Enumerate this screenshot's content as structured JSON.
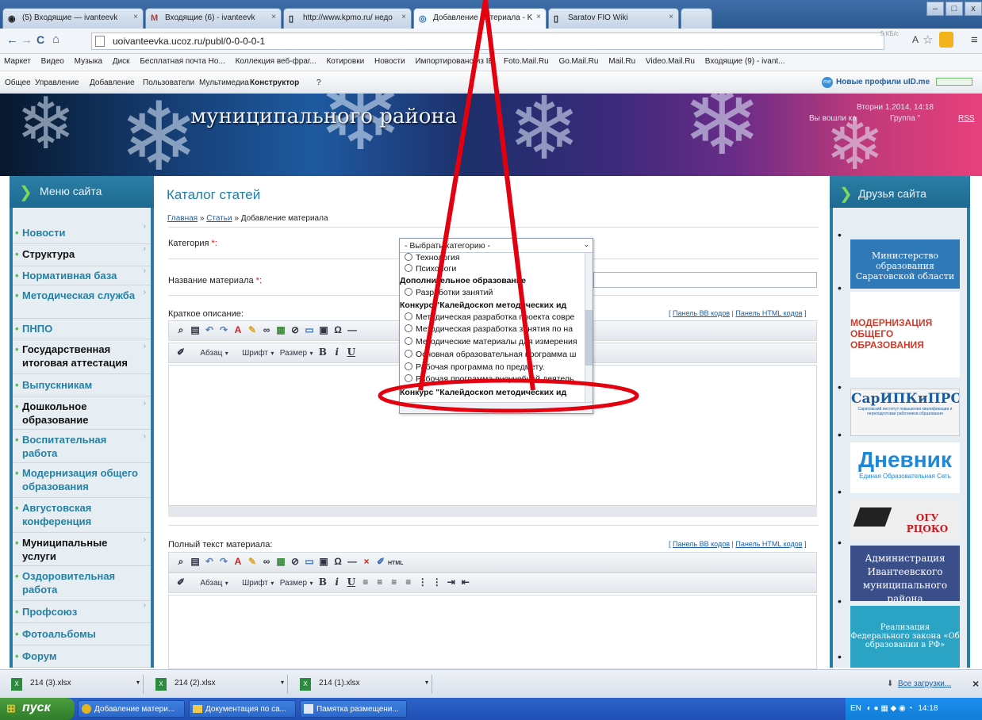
{
  "browser": {
    "tabs": [
      {
        "label": "(5) Входящие — ivanteevk",
        "icon": "◉"
      },
      {
        "label": "Входящие (6) - ivanteevk",
        "icon": "M"
      },
      {
        "label": "http://www.kpmo.ru/ недо",
        "icon": "▯"
      },
      {
        "label": "Добавление материала - K",
        "icon": "◎"
      },
      {
        "label": "Saratov FIO Wiki",
        "icon": "▯"
      }
    ],
    "url": "uoivanteevka.ucoz.ru/publ/0-0-0-0-1",
    "speed": "5 КБ/с",
    "bookmarks": [
      "Маркет",
      "Видео",
      "Музыка",
      "Диск",
      "Бесплатная почта Но...",
      "Коллекция веб-фраг...",
      "Котировки",
      "Новости",
      "Импортировано из IE",
      "Foto.Mail.Ru",
      "Go.Mail.Ru",
      "Mail.Ru",
      "Video.Mail.Ru",
      "Входящие (9) - ivant..."
    ]
  },
  "ucoz_bar": {
    "items": [
      "Общее",
      "Управление",
      "Добавление",
      "Пользователи",
      "Мультимедиа"
    ],
    "active": "Конструктор",
    "help": "?",
    "profiles_label": "Новые профили uID.me"
  },
  "banner": {
    "title": "муниципального района",
    "date": "Вторни 1.2014, 14:18",
    "login": "Вы вошли ка",
    "group": "Группа \"",
    "rss": "RSS"
  },
  "left_menu": {
    "title": "Меню сайта",
    "items": [
      "Новости",
      "Структура",
      "Нормативная база",
      "Методическая служба",
      "ПНПО",
      "Государственная итоговая аттестация",
      "Выпускникам",
      "Дошкольное образование",
      "Воспитательная работа",
      "Модернизация общего образования",
      "Августовская конференция",
      "Муниципальные услуги",
      "Оздоровительная работа",
      "Профсоюз",
      "Фотоальбомы",
      "Форум"
    ]
  },
  "main": {
    "title": "Каталог статей",
    "breadcrumb": {
      "home": "Главная",
      "sep": " » ",
      "articles": "Статьи",
      "current": "Добавление материала"
    },
    "category_label": "Категория",
    "name_label": "Название материала",
    "required": "*:",
    "short_label": "Краткое описание:",
    "full_label": "Полный текст материала:",
    "bb_link": "Панель BB кодов",
    "html_link": "Панель HTML кодов",
    "format": {
      "paragraph": "Абзац",
      "font": "Шрифт",
      "size": "Размер"
    }
  },
  "dropdown": {
    "selected": "- Выбрать категорию -",
    "options": [
      {
        "text": "Технология",
        "group": false
      },
      {
        "text": "Психологи",
        "group": false
      },
      {
        "text": "Дополнительное образование",
        "group": true
      },
      {
        "text": "Разработки занятий",
        "group": false
      },
      {
        "text": "Конкурс \"Калейдоскоп методических ид",
        "group": true
      },
      {
        "text": "Методическая разработка проекта совре",
        "group": false
      },
      {
        "text": "Методическая разработка занятия по на",
        "group": false
      },
      {
        "text": "Методические материалы для измерения",
        "group": false
      },
      {
        "text": "Основная образовательная программа ш",
        "group": false
      },
      {
        "text": "Рабочая программа по предмету.",
        "group": false
      },
      {
        "text": "Рабочая программа внеучебной деятель",
        "group": false
      },
      {
        "text": "Конкурс \"Калейдоскоп методических ид",
        "group": true
      }
    ]
  },
  "right_panel": {
    "title": "Друзья сайта",
    "ads": [
      {
        "text": "Министерство образования Саратовской области",
        "color": "#2f79b9"
      },
      {
        "text": "МОДЕРНИЗАЦИЯ ОБЩЕГО ОБРАЗОВАНИЯ",
        "color": "#d23a2a"
      },
      {
        "text": "СарИПКиПРО",
        "color": "#1e5d9a"
      },
      {
        "text": "Саратовский институт повышения квалификации и переподготовки работников образования",
        "color": "#1e5d9a"
      },
      {
        "text": "Дневник",
        "color": "#1e88d6"
      },
      {
        "text": "Единая Образовательная Сеть",
        "color": "#1e88d6"
      },
      {
        "text": "ОГУ РЦОКО",
        "color": "#c8191f"
      },
      {
        "text": "Администрация Ивантеевского муниципального района",
        "color": "#3a4f8a"
      },
      {
        "text": "Реализация Федерального закона «Об образовании в РФ»",
        "color": "#2aa3c5"
      }
    ]
  },
  "downloads": {
    "files": [
      "214 (3).xlsx",
      "214 (2).xlsx",
      "214 (1).xlsx"
    ],
    "all_label": "Все загрузки..."
  },
  "taskbar": {
    "start": "пуск",
    "tasks": [
      "Добавление матери...",
      "Документация по са...",
      "Памятка размещени..."
    ],
    "lang": "EN",
    "time": "14:18"
  },
  "annotation_color": "#e3000f"
}
